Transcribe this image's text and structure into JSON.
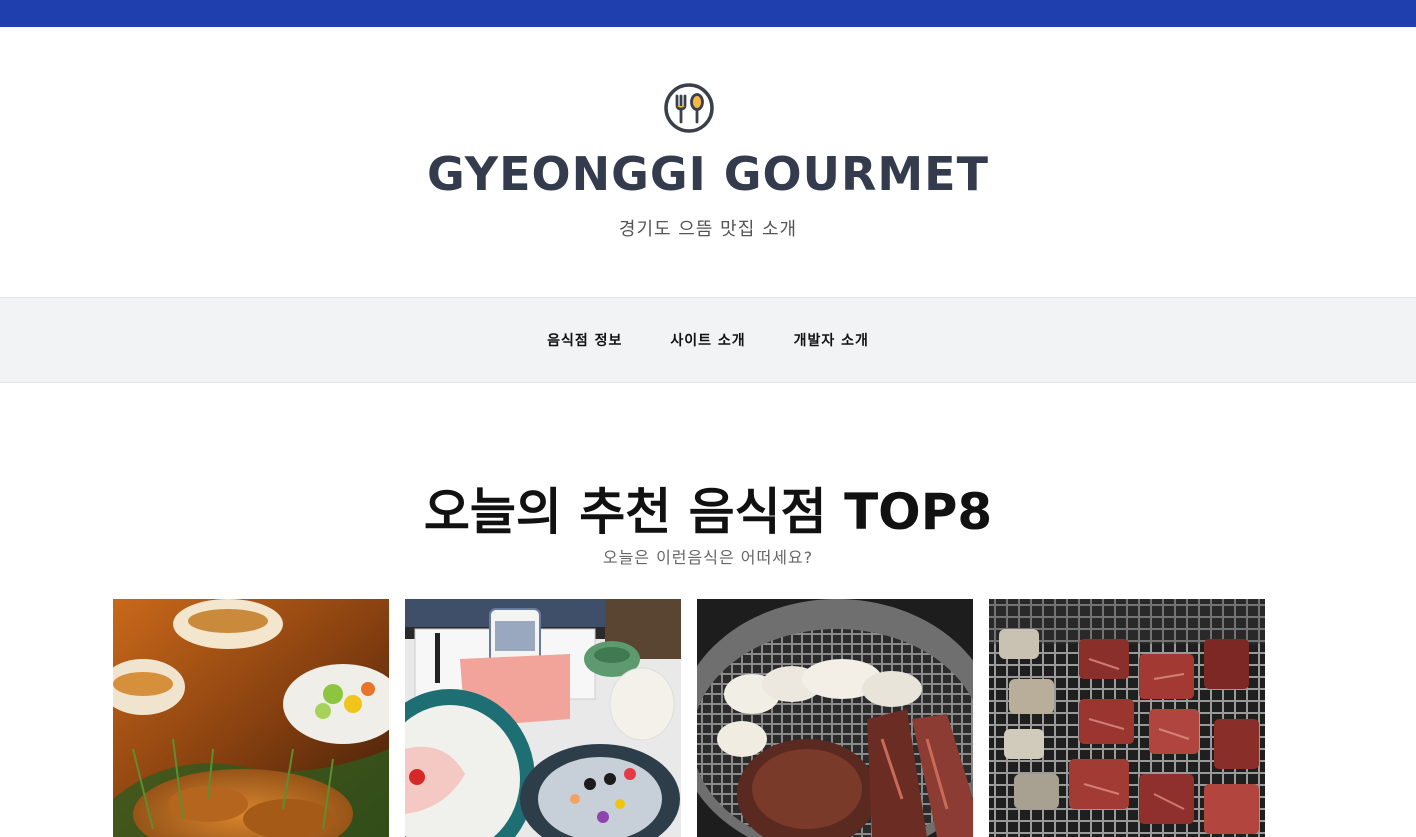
{
  "header": {
    "site_title": "GYEONGGI GOURMET",
    "tagline": "경기도 으뜸 맛집 소개",
    "logo_icon": "utensils-plate-icon"
  },
  "nav": {
    "items": [
      {
        "label": "음식점 정보"
      },
      {
        "label": "사이트 소개"
      },
      {
        "label": "개발자 소개"
      }
    ]
  },
  "main": {
    "title": "오늘의 추천 음식점 TOP8",
    "subtitle": "오늘은 이런음식은 어떠세요?",
    "cards": [
      {
        "image": "roast-chicken-photo"
      },
      {
        "image": "sashimi-table-photo"
      },
      {
        "image": "grilled-beef-photo"
      },
      {
        "image": "beef-cubes-grill-photo"
      }
    ]
  },
  "colors": {
    "topbar": "#1f3fae",
    "nav_bg": "#f2f3f4",
    "title": "#333b4d"
  }
}
